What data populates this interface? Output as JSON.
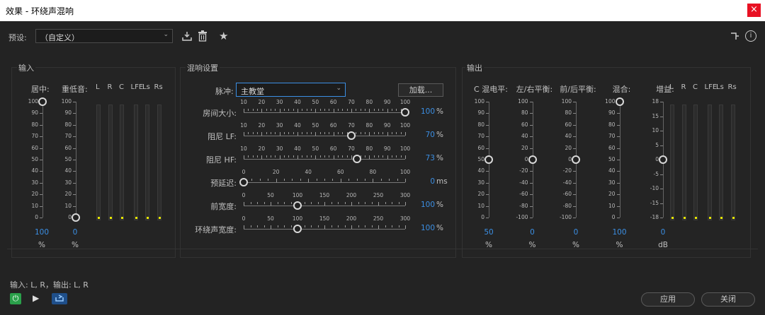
{
  "window": {
    "title": "效果 - 环绕声混响",
    "close": "×"
  },
  "toolbar": {
    "preset_label": "预设:",
    "preset_value": "（自定义）"
  },
  "input": {
    "title": "输入",
    "center_label": "居中:",
    "lfe_label": "重低音:",
    "center_value": "100",
    "center_unit": "%",
    "lfe_value": "0",
    "lfe_unit": "%",
    "center_level": 1.0,
    "lfe_level": 0.0,
    "scale": [
      "100",
      "90",
      "80",
      "70",
      "60",
      "50",
      "40",
      "30",
      "20",
      "10",
      "0"
    ],
    "meters": [
      "L",
      "R",
      "C",
      "LFE",
      "Ls",
      "Rs"
    ]
  },
  "reverb": {
    "title": "混响设置",
    "impulse_label": "脉冲:",
    "impulse_value": "主教堂",
    "load_button": "加载...",
    "sliders": [
      {
        "label": "房间大小:",
        "value": "100",
        "unit": "%",
        "fraction": 1.0,
        "ticks": [
          "10",
          "20",
          "30",
          "40",
          "50",
          "60",
          "70",
          "80",
          "90",
          "100"
        ]
      },
      {
        "label": "阻尼 LF:",
        "value": "70",
        "unit": "%",
        "fraction": 0.667,
        "ticks": [
          "10",
          "20",
          "30",
          "40",
          "50",
          "60",
          "70",
          "80",
          "90",
          "100"
        ]
      },
      {
        "label": "阻尼 HF:",
        "value": "73",
        "unit": "%",
        "fraction": 0.7,
        "ticks": [
          "10",
          "20",
          "30",
          "40",
          "50",
          "60",
          "70",
          "80",
          "90",
          "100"
        ]
      },
      {
        "label": "预延迟:",
        "value": "0",
        "unit": "ms",
        "fraction": 0.0,
        "ticks": [
          "0",
          "20",
          "40",
          "60",
          "80",
          "100"
        ]
      },
      {
        "label": "前宽度:",
        "value": "100",
        "unit": "%",
        "fraction": 0.333,
        "ticks": [
          "0",
          "50",
          "100",
          "150",
          "200",
          "250",
          "300"
        ]
      },
      {
        "label": "环绕声宽度:",
        "value": "100",
        "unit": "%",
        "fraction": 0.333,
        "ticks": [
          "0",
          "50",
          "100",
          "150",
          "200",
          "250",
          "300"
        ]
      }
    ]
  },
  "output": {
    "title": "输出",
    "columns": [
      {
        "label": "C 混电平:",
        "value": "50",
        "unit": "%",
        "fraction": 0.5,
        "scale": [
          "100",
          "90",
          "80",
          "70",
          "60",
          "50",
          "40",
          "30",
          "20",
          "10",
          "0"
        ]
      },
      {
        "label": "左/右平衡:",
        "value": "0",
        "unit": "%",
        "fraction": 0.5,
        "scale": [
          "100",
          "80",
          "60",
          "40",
          "20",
          "0",
          "-20",
          "-40",
          "-60",
          "-80",
          "-100"
        ]
      },
      {
        "label": "前/后平衡:",
        "value": "0",
        "unit": "%",
        "fraction": 0.5,
        "scale": [
          "100",
          "80",
          "60",
          "40",
          "20",
          "0",
          "-20",
          "-40",
          "-60",
          "-80",
          "-100"
        ]
      },
      {
        "label": "混合:",
        "value": "100",
        "unit": "%",
        "fraction": 1.0,
        "scale": [
          "100",
          "90",
          "80",
          "70",
          "60",
          "50",
          "40",
          "30",
          "20",
          "10",
          "0"
        ]
      },
      {
        "label": "增益:",
        "value": "0",
        "unit": "dB",
        "fraction": 0.5,
        "scale": [
          "18",
          "15",
          "10",
          "5",
          "0",
          "-5",
          "-10",
          "-15",
          "-18"
        ]
      }
    ],
    "meters": [
      "L",
      "R",
      "C",
      "LFE",
      "Ls",
      "Rs"
    ]
  },
  "footer": {
    "io_text": "输入: L, R，输出: L, R",
    "apply_button": "应用",
    "close_button": "关闭"
  }
}
